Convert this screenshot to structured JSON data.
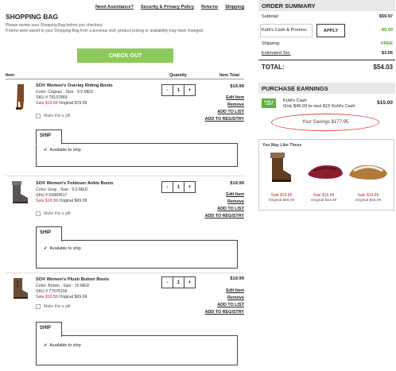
{
  "top_links": [
    "Need Assistance?",
    "Security & Privacy Policy",
    "Returns",
    "Shipping"
  ],
  "bag": {
    "title": "SHOPPING BAG",
    "note_1": "Please review your Shopping Bag before you checkout.",
    "note_2": "If items were saved to your Shopping Bag from a previous visit, product pricing or availability may have changed.",
    "checkout_label": "CHECK OUT",
    "col_item": "Item",
    "col_qty": "Quantity",
    "col_total": "Item Total"
  },
  "items": [
    {
      "name": "SO® Women's Overlay Riding Boots",
      "color": "Color: Cognac , Size : 9.5 MED",
      "sku": "SKU # 79137869",
      "sale": "Sale $19.99",
      "original": "Original $79.99",
      "qty": "1",
      "total": "$19.99",
      "gift": "Make this a gift"
    },
    {
      "name": "SO® Women's Foldover Ankle Boots",
      "color": "Color: Gray , Size : 9.5 MED",
      "sku": "SKU # 60884517",
      "sale": "Sale $19.99",
      "original": "Original $69.99",
      "qty": "1",
      "total": "$19.99",
      "gift": "Make this a gift"
    },
    {
      "name": "SO® Women's Plush Button Boots",
      "color": "Color: Brown , Size : 10 MED",
      "sku": "SKU # 77576156",
      "sale": "Sale $19.99",
      "original": "Original $69.99",
      "qty": "1",
      "total": "$19.99",
      "gift": "Make this a gift"
    }
  ],
  "actions": {
    "edit": "Edit Item",
    "remove": "Remove",
    "list": "ADD TO LIST",
    "registry": "ADD TO REGISTRY"
  },
  "ship": {
    "tab": "SHIP",
    "option": "Available to ship",
    "minus": "-",
    "plus": "+"
  },
  "summary": {
    "title": "ORDER SUMMARY",
    "subtotal_label": "Subtotal:",
    "subtotal": "$59.97",
    "promo_label": "Kohl's Cash & Promos:",
    "apply": "APPLY",
    "promo_value": "- $9.00",
    "shipping_label": "Shipping:",
    "shipping": "FREE",
    "tax_label": "Estimated Tax:",
    "tax": "$3.06",
    "total_label": "TOTAL:",
    "total": "$54.03"
  },
  "earnings": {
    "title": "PURCHASE EARNINGS",
    "badge": "KOHL'S CASH",
    "label": "Kohl's Cash",
    "note": "Only $49.03 to next $15 Kohl's Cash",
    "amount": "$15.00",
    "savings": "Your Savings $177.95"
  },
  "like": {
    "title": "You May Like These",
    "items": [
      {
        "sale": "Sale $29.99",
        "orig": "Original $59.99"
      },
      {
        "sale": "Sale $16.99",
        "orig": "Original $24.99"
      },
      {
        "sale": "Sale $14.99",
        "orig": "Original $44.99"
      }
    ]
  }
}
